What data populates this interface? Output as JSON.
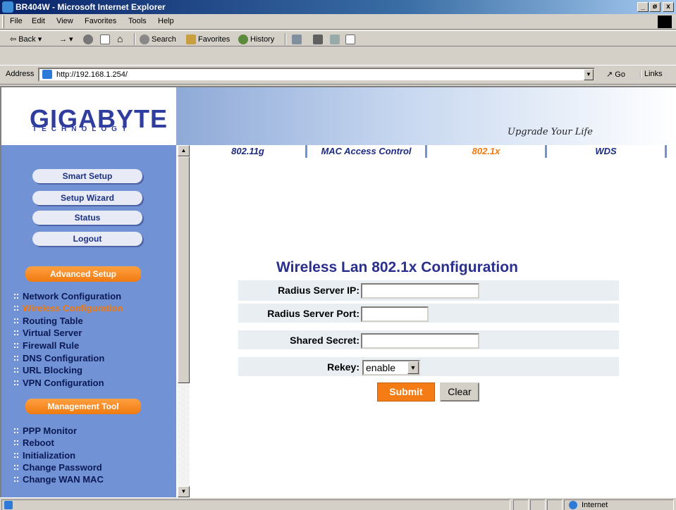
{
  "window": {
    "title": "BR404W - Microsoft Internet Explorer",
    "controls": [
      "_",
      "ø",
      "x"
    ]
  },
  "menu": [
    "File",
    "Edit",
    "View",
    "Favorites",
    "Tools",
    "Help"
  ],
  "toolbar": {
    "back": "Back",
    "search": "Search",
    "favorites": "Favorites",
    "history": "History"
  },
  "address": {
    "label": "Address",
    "url": "http://192.168.1.254/",
    "go": "Go",
    "links": "Links"
  },
  "header": {
    "brand": "GIGABYTE",
    "brand_sub": "TECHNOLOGY",
    "slogan": "Upgrade Your Life"
  },
  "sidebar": {
    "buttons": [
      "Smart Setup",
      "Setup Wizard",
      "Status",
      "Logout"
    ],
    "section_advanced": "Advanced Setup",
    "advanced_links": [
      "Network Configuration",
      "Wireless Configuration",
      "Routing Table",
      "Virtual Server",
      "Firewall Rule",
      "DNS Configuration",
      "URL Blocking",
      "VPN Configuration"
    ],
    "section_management": "Management Tool",
    "management_links": [
      "PPP Monitor",
      "Reboot",
      "Initialization",
      "Change Password",
      "Change WAN MAC"
    ]
  },
  "tabs": [
    "802.11g",
    "MAC Access Control",
    "802.1x",
    "WDS"
  ],
  "form": {
    "title": "Wireless Lan 802.1x Configuration",
    "radius_ip_label": "Radius Server IP:",
    "radius_ip_value": "",
    "radius_port_label": "Radius Server Port:",
    "radius_port_value": "",
    "shared_secret_label": "Shared Secret:",
    "shared_secret_value": "",
    "rekey_label": "Rekey:",
    "rekey_value": "enable",
    "submit": "Submit",
    "clear": "Clear"
  },
  "status": {
    "zone": "Internet"
  },
  "colors": {
    "sidebar": "#7192d4",
    "accent": "#f07a10",
    "title": "#2a2f8e"
  }
}
